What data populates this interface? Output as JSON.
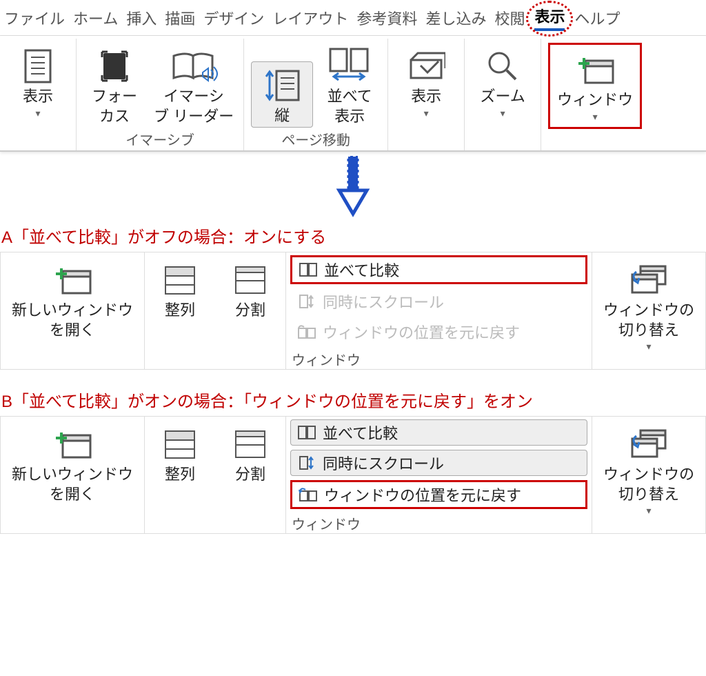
{
  "tabs": {
    "file": "ファイル",
    "home": "ホーム",
    "insert": "挿入",
    "draw": "描画",
    "design": "デザイン",
    "layout": "レイアウト",
    "references": "参考資料",
    "mailings": "差し込み",
    "review": "校閲",
    "view": "表示",
    "help": "ヘルプ"
  },
  "ribbon": {
    "display": "表示",
    "focus": "フォー\nカス",
    "immersive_reader": "イマーシ\nブ リーダー",
    "vertical": "縦",
    "side_by_side": "並べて\n表示",
    "display2": "表示",
    "zoom": "ズーム",
    "window": "ウィンドウ",
    "group_immersive": "イマーシブ",
    "group_page_move": "ページ移動"
  },
  "captions": {
    "a": "A「並べて比較」がオフの場合：オンにする",
    "b": "B「並べて比較」がオンの場合：「ウィンドウの位置を元に戻す」をオン"
  },
  "window_menu": {
    "new_window": "新しいウィンドウ\nを開く",
    "arrange": "整列",
    "split": "分割",
    "compare": "並べて比較",
    "sync_scroll": "同時にスクロール",
    "reset_position": "ウィンドウの位置を元に戻す",
    "switch": "ウィンドウの\n切り替え",
    "group_label": "ウィンドウ"
  }
}
